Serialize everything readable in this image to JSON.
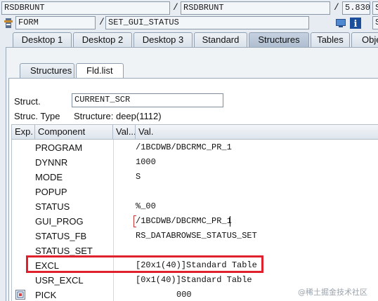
{
  "top": {
    "row1": {
      "field_a": "RSDBRUNT",
      "field_b": "RSDBRUNT",
      "version": "5.830",
      "trailing": "S"
    },
    "row2": {
      "type": "FORM",
      "value": "SET_GUI_STATUS",
      "trailing": "S"
    }
  },
  "tabs": [
    {
      "label": "Desktop 1"
    },
    {
      "label": "Desktop 2"
    },
    {
      "label": "Desktop 3"
    },
    {
      "label": "Standard"
    },
    {
      "label": "Structures"
    },
    {
      "label": "Tables"
    },
    {
      "label": "Obje"
    }
  ],
  "subtabs": [
    {
      "label": "Structures"
    },
    {
      "label": "Fld.list"
    }
  ],
  "struct": {
    "label": "Struct.",
    "value": "CURRENT_SCR",
    "type_label": "Struc. Type",
    "type_value": "Structure: deep(1112)"
  },
  "grid": {
    "headers": [
      "Exp.",
      "Component",
      "Val...",
      "Val."
    ],
    "rows": [
      {
        "component": "PROGRAM",
        "value": "/1BCDWB/DBCRMC_PR_1"
      },
      {
        "component": "DYNNR",
        "value": "1000"
      },
      {
        "component": "MODE",
        "value": "S"
      },
      {
        "component": "POPUP",
        "value": ""
      },
      {
        "component": "STATUS",
        "value": "%_00"
      },
      {
        "component": "GUI_PROG",
        "value": "/1BCDWB/DBCRMC_PR_1"
      },
      {
        "component": "STATUS_FB",
        "value": "RS_DATABROWSE_STATUS_SET"
      },
      {
        "component": "STATUS_SET",
        "value": ""
      },
      {
        "component": "EXCL",
        "value": "[20x1(40)]Standard Table"
      },
      {
        "component": "USR_EXCL",
        "value": "[0x1(40)]Standard Table"
      },
      {
        "component": "PICK",
        "value": "000"
      }
    ]
  },
  "watermark": "@稀土掘金技术社区",
  "colors": {
    "highlight": "#e0202c",
    "active_tab": "#aebdd0",
    "background": "#e6ecf2"
  },
  "icons": [
    "program-icon",
    "display-icon",
    "info-icon",
    "expand-icon"
  ]
}
